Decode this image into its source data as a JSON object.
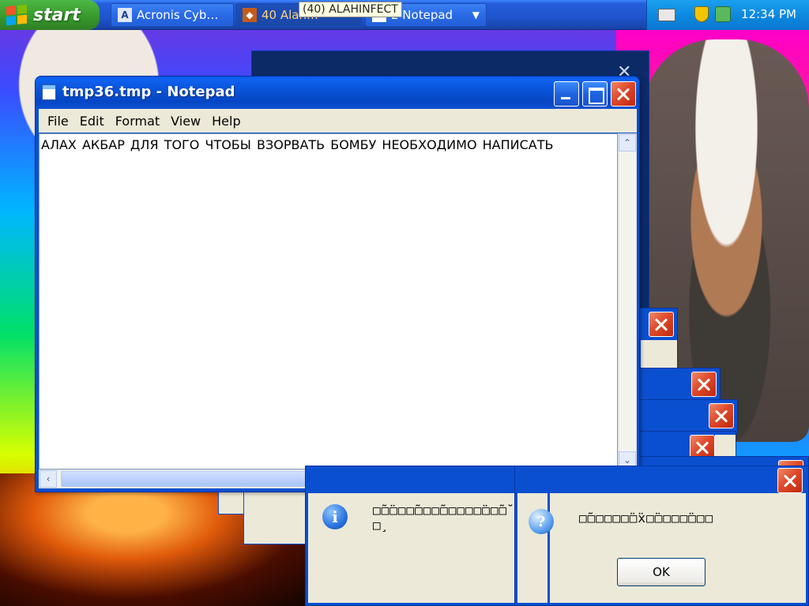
{
  "taskbar": {
    "start_label": "start",
    "tooltip": "(40) ALAHINFECT",
    "buttons": [
      {
        "label": "Acronis Cyb…",
        "icon": "acronis-icon"
      },
      {
        "label": "40 Alah…",
        "icon": "alah-icon"
      },
      {
        "label": "2 Notepad",
        "icon": "notepad-icon"
      }
    ],
    "clock": "12:34 PM"
  },
  "notepad": {
    "title": "tmp36.tmp - Notepad",
    "menu": [
      "File",
      "Edit",
      "Format",
      "View",
      "Help"
    ],
    "text": "АЛАХ АКБАР ДЛЯ ТОГО ЧТОБЫ ВЗОРВАТЬ БОМБУ НЕОБХОДИМО НАПИСАТЬ"
  },
  "dialogs": {
    "info_text": "□̃□̈□□□̃□□□̃□□□□□̈□□̃□̆\n□̧",
    "question_text": "□̃□□□□□̈□̈x□̈□□□□̈□□□",
    "ok_label": "OK",
    "info_icon": "info-icon",
    "question_icon": "question-icon"
  },
  "colors": {
    "xp_blue": "#0a4fd0",
    "close_red": "#de4a2a",
    "start_green": "#389a2c"
  }
}
